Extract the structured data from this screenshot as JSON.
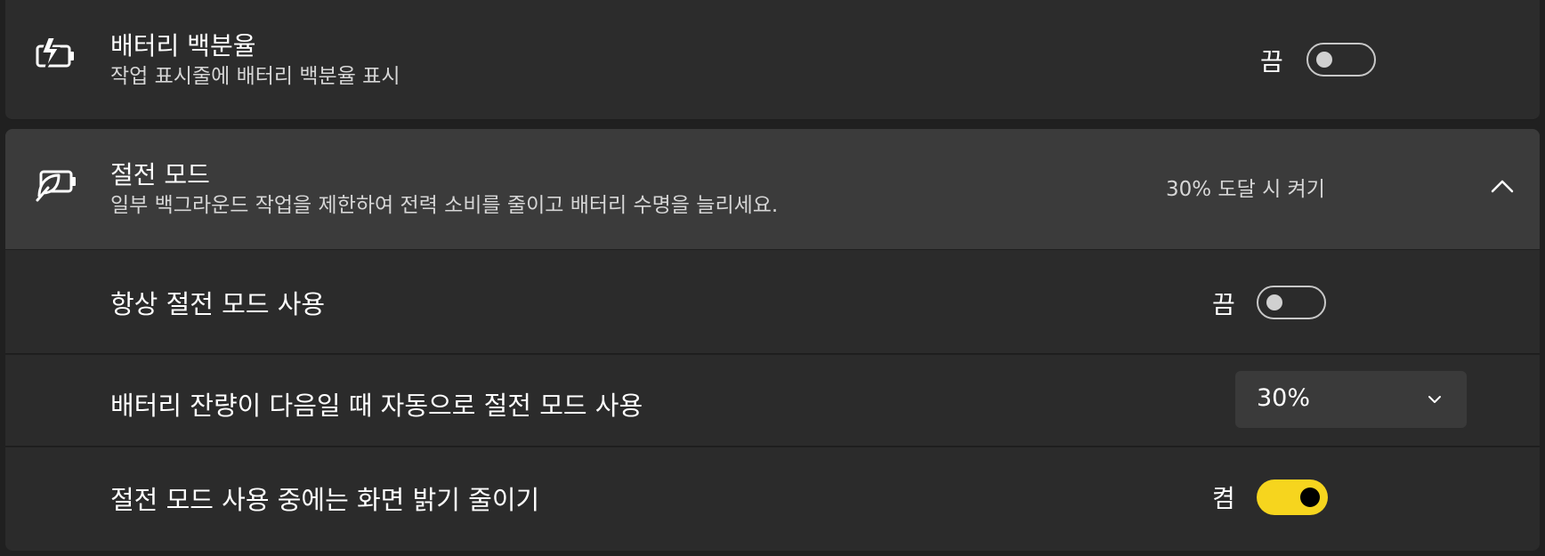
{
  "battery_percentage": {
    "title": "배터리 백분율",
    "description": "작업 표시줄에 배터리 백분율 표시",
    "state_label": "끔",
    "toggle_on": false,
    "icon": "battery-charging-icon"
  },
  "battery_saver": {
    "title": "절전 모드",
    "description": "일부 백그라운드 작업을 제한하여 전력 소비를 줄이고 배터리 수명을 늘리세요.",
    "status": "30% 도달 시 켜기",
    "icon": "battery-saver-leaf-icon",
    "expanded": true,
    "options": {
      "always_on": {
        "label": "항상 절전 모드 사용",
        "state_label": "끔",
        "toggle_on": false
      },
      "auto_threshold": {
        "label": "배터리 잔량이 다음일 때 자동으로 절전 모드 사용",
        "selected_value": "30%"
      },
      "lower_brightness": {
        "label": "절전 모드 사용 중에는 화면 밝기 줄이기",
        "state_label": "켬",
        "toggle_on": true
      }
    }
  },
  "colors": {
    "accent": "#f6d51e",
    "background": "#202020",
    "card": "#2d2d2d",
    "card_header_expanded": "#3b3b3b"
  }
}
